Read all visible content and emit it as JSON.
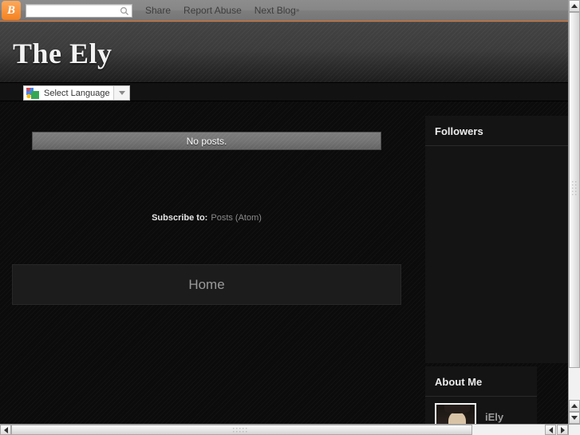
{
  "navbar": {
    "logo_icon": "blogger-b-icon",
    "logo_letter": "B",
    "search": {
      "value": "",
      "placeholder": "",
      "icon": "search-icon"
    },
    "links": [
      {
        "label": "Share"
      },
      {
        "label": "Report Abuse"
      },
      {
        "label": "Next Blog",
        "suffix": "»"
      }
    ]
  },
  "header": {
    "blog_title": "The Ely"
  },
  "translate": {
    "logo_icon": "google-translate-icon",
    "label": "Select Language",
    "dropdown_icon": "chevron-down-icon"
  },
  "main": {
    "no_posts": "No posts.",
    "home_link": "Home",
    "subscribe_label": "Subscribe to:",
    "subscribe_link": "Posts (Atom)"
  },
  "sidebar": {
    "followers": {
      "title": "Followers"
    },
    "about_me": {
      "title": "About Me",
      "profile_name": "iEly",
      "avatar_icon": "profile-photo"
    }
  },
  "scrollbars": {
    "vertical": {
      "up_icon": "arrow-up-icon",
      "down_icon": "arrow-down-icon"
    },
    "horizontal": {
      "left_icon": "arrow-left-icon",
      "right_icon": "arrow-right-icon"
    }
  },
  "colors": {
    "navbar_bg": "#828282",
    "navbar_accent": "#e7762c",
    "blogger_orange": "#f58220",
    "page_bg": "#0b0b0b",
    "header_bg": "#3b3b3b",
    "no_posts_bg": "#747474",
    "scrollbar_track": "#f1f1f1"
  }
}
